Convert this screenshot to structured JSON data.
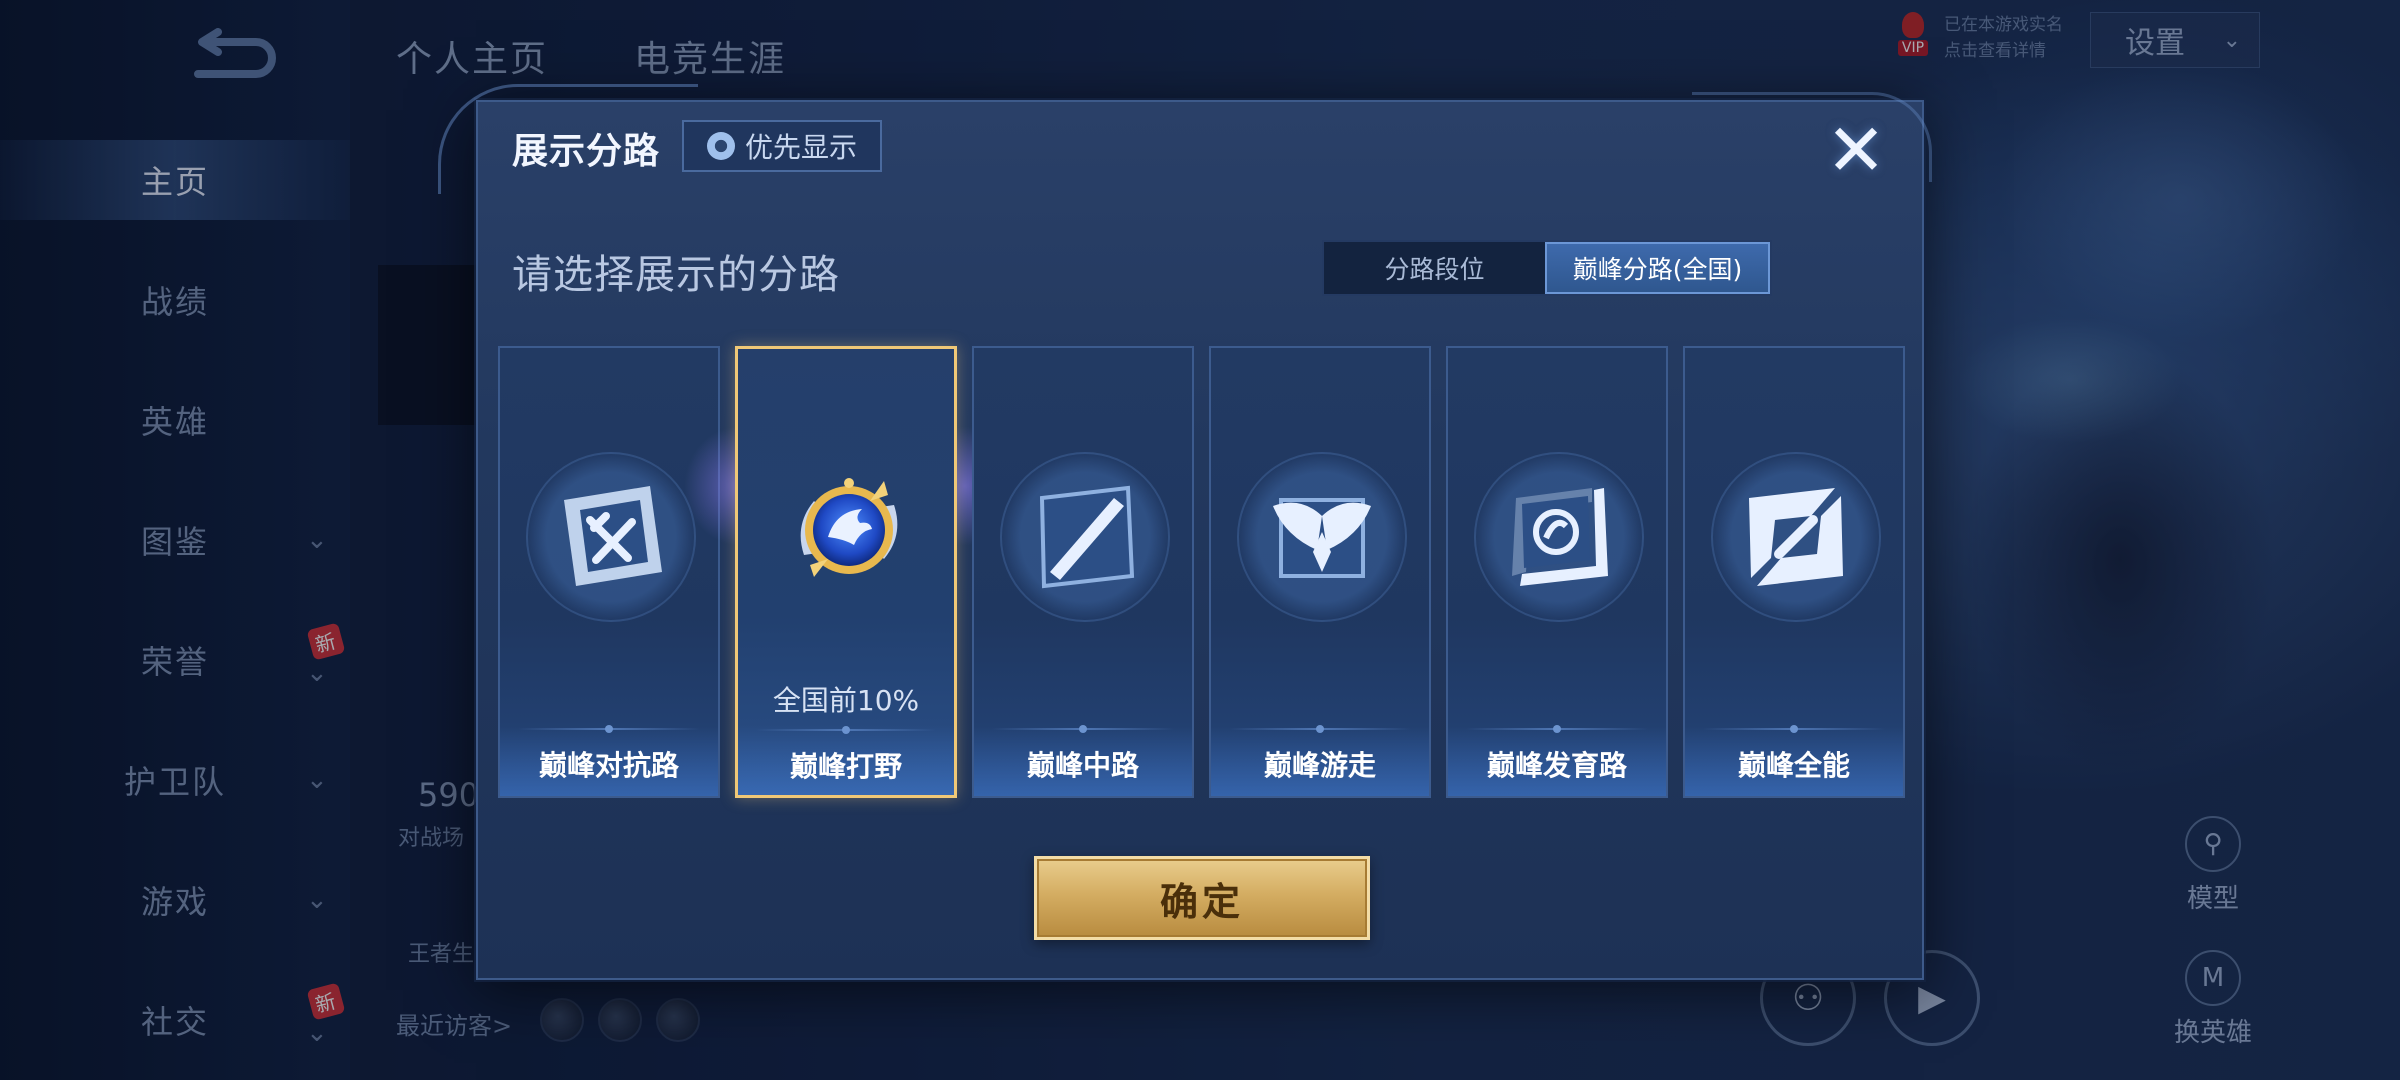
{
  "nav": {
    "items": [
      {
        "label": "主页",
        "active": true,
        "chevron": false,
        "new": false
      },
      {
        "label": "战绩",
        "active": false,
        "chevron": false,
        "new": false
      },
      {
        "label": "英雄",
        "active": false,
        "chevron": false,
        "new": false
      },
      {
        "label": "图鉴",
        "active": false,
        "chevron": true,
        "new": false
      },
      {
        "label": "荣誉",
        "active": false,
        "chevron": true,
        "new": true
      },
      {
        "label": "护卫队",
        "active": false,
        "chevron": true,
        "new": false
      },
      {
        "label": "游戏",
        "active": false,
        "chevron": true,
        "new": false
      },
      {
        "label": "社交",
        "active": false,
        "chevron": true,
        "new": true
      }
    ],
    "new_badge": "新",
    "chevron": "⌄"
  },
  "top_tabs": {
    "personal": "个人主页",
    "esports": "电竞生涯"
  },
  "vip": {
    "tag": "VIP",
    "line1": "已在本游戏实名",
    "line2": "点击查看详情"
  },
  "settings_label": "设置",
  "background": {
    "stat": "590",
    "stat_sub": "对战场",
    "king": "王者生",
    "recent_visitors": "最近访客>"
  },
  "side": {
    "model_label": "模型",
    "switch_hero_label": "换英雄"
  },
  "modal": {
    "title": "展示分路",
    "priority_label": "优先显示",
    "close_icon": "✕",
    "subtitle": "请选择展示的分路",
    "segment": [
      {
        "label": "分路段位",
        "active": false
      },
      {
        "label": "巅峰分路(全国)",
        "active": true
      }
    ],
    "cards": [
      {
        "label": "巅峰对抗路",
        "icon": "clash-lane-icon",
        "selected": false,
        "rank": ""
      },
      {
        "label": "巅峰打野",
        "icon": "jungle-dragon-emblem-icon",
        "selected": true,
        "rank": "全国前10%"
      },
      {
        "label": "巅峰中路",
        "icon": "mid-lane-icon",
        "selected": false,
        "rank": ""
      },
      {
        "label": "巅峰游走",
        "icon": "roam-wings-icon",
        "selected": false,
        "rank": ""
      },
      {
        "label": "巅峰发育路",
        "icon": "farm-lane-icon",
        "selected": false,
        "rank": ""
      },
      {
        "label": "巅峰全能",
        "icon": "all-round-icon",
        "selected": false,
        "rank": ""
      }
    ],
    "confirm_label": "确定"
  },
  "colors": {
    "selected_border": "#f0c877",
    "confirm_gold": "#d4ad62",
    "modal_bg": "#22385e",
    "segment_active": "#3e6aac"
  }
}
